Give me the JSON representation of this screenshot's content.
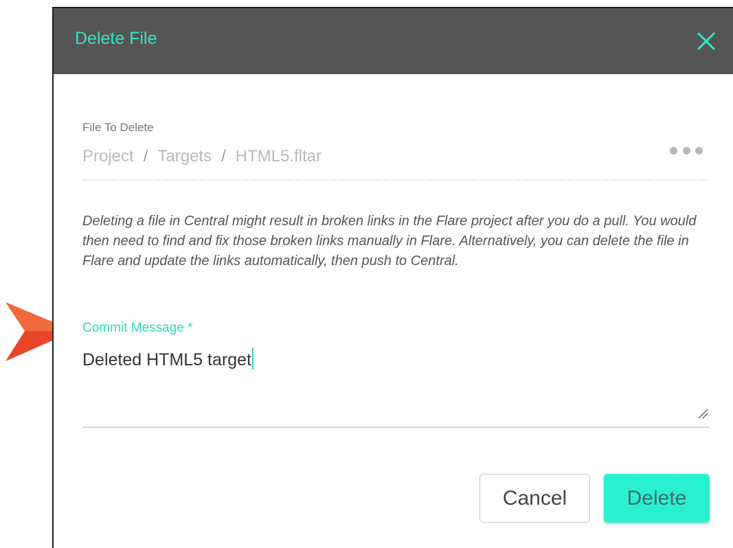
{
  "dialog": {
    "title": "Delete File",
    "close_icon": "close-icon"
  },
  "file": {
    "label": "File To Delete",
    "breadcrumb": [
      "Project",
      "Targets",
      "HTML5.fltar"
    ],
    "separator": "/",
    "more_icon": "more-horizontal-icon"
  },
  "warning_text": "Deleting a file in Central might result in broken links in the Flare project after you do a pull. You would then need to find and fix those broken links manually in Flare. Alternatively, you can delete the file in Flare and update the links automatically, then push to Central.",
  "commit": {
    "label": "Commit Message *",
    "value": "Deleted HTML5 target"
  },
  "buttons": {
    "cancel": "Cancel",
    "delete": "Delete"
  },
  "colors": {
    "header_bg": "#555555",
    "accent": "#33e6c3",
    "delete_button": "#2af0d2",
    "callout_arrow": "#e8462a"
  }
}
